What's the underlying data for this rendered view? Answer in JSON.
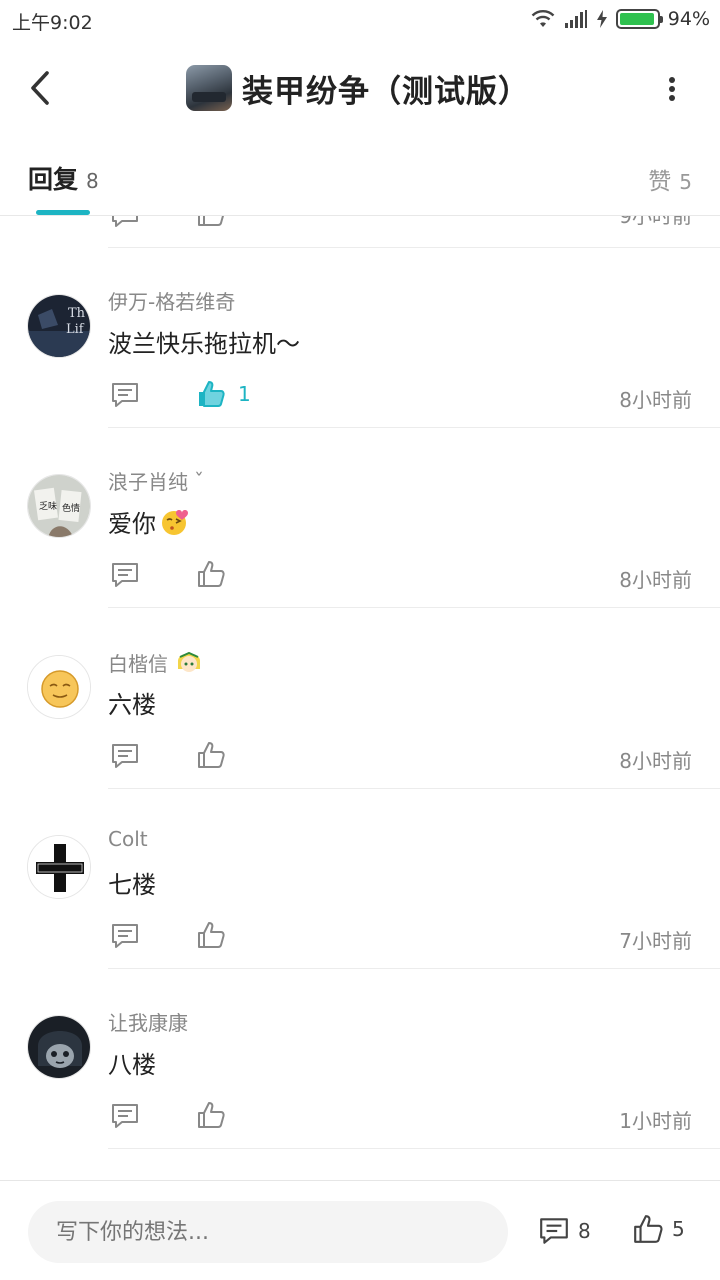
{
  "status_bar": {
    "time": "上午9:02",
    "battery_percent": "94%",
    "battery_level": 0.94
  },
  "header": {
    "title": "装甲纷争（测试版）",
    "back_icon": "chevron-left-icon",
    "more_icon": "more-vertical-icon"
  },
  "tabs": {
    "reply_label": "回复",
    "reply_count": "8",
    "like_label": "赞",
    "like_count": "5"
  },
  "partial_row": {
    "time": "9小时前"
  },
  "comments": [
    {
      "name": "伊万-格若维奇",
      "text": "波兰快乐拖拉机～",
      "like_count": "1",
      "liked": true,
      "time": "8小时前"
    },
    {
      "name": "浪子肖纯",
      "name_badge": "ˇ",
      "text": "爱你",
      "emoji": "kiss-emoji",
      "like_count": "",
      "liked": false,
      "time": "8小时前"
    },
    {
      "name": "白楷信",
      "name_badge_icon": "avatar-badge-icon",
      "text": "六楼",
      "like_count": "",
      "liked": false,
      "time": "8小时前"
    },
    {
      "name": "Colt",
      "text": "七楼",
      "like_count": "",
      "liked": false,
      "time": "7小时前"
    },
    {
      "name": "让我康康",
      "text": "八楼",
      "like_count": "",
      "liked": false,
      "time": "1小时前"
    }
  ],
  "bottom_bar": {
    "input_placeholder": "写下你的想法...",
    "comment_count": "8",
    "like_count": "5"
  },
  "colors": {
    "accent": "#1db4c3",
    "text_primary": "#222222",
    "text_secondary": "#888888"
  }
}
